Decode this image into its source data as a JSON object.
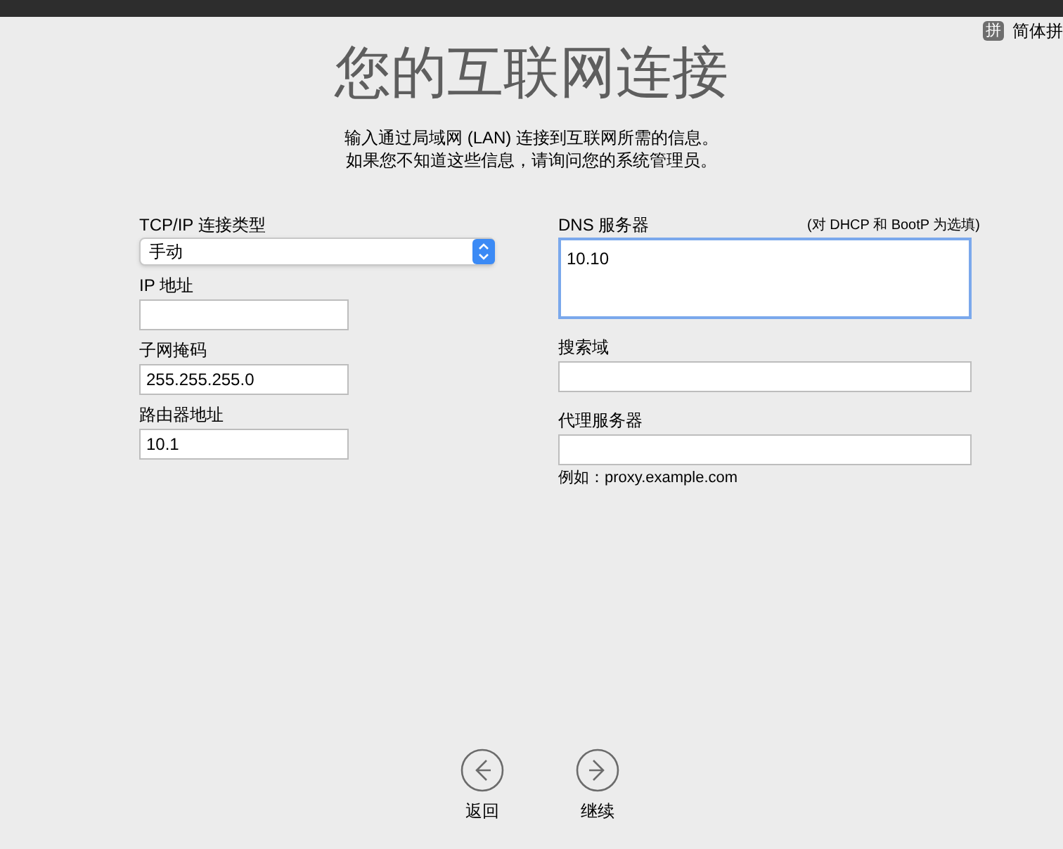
{
  "input_menu": {
    "badge": "拼",
    "label": "简体拼"
  },
  "title": "您的互联网连接",
  "description": [
    "输入通过局域网 (LAN) 连接到互联网所需的信息。",
    "如果您不知道这些信息，请询问您的系统管理员。"
  ],
  "left_fields": [
    {
      "kind": "select",
      "label": "TCP/IP 连接类型",
      "value": "手动"
    },
    {
      "kind": "text",
      "label": "IP 地址"
    },
    {
      "kind": "text",
      "label": "子网掩码",
      "value": "255.255.255.0"
    },
    {
      "kind": "text",
      "label": "路由器地址",
      "value": "10.1"
    }
  ],
  "dns": {
    "label": "DNS 服务器",
    "note": "(对 DHCP 和 BootP 为选填)",
    "value": "10.10",
    "focused": true
  },
  "right_fields": [
    {
      "label": "搜索域"
    },
    {
      "label": "代理服务器",
      "hint": "例如：proxy.example.com"
    }
  ],
  "nav": [
    {
      "kind": "back",
      "label": "返回"
    },
    {
      "kind": "forward",
      "label": "继续"
    }
  ]
}
